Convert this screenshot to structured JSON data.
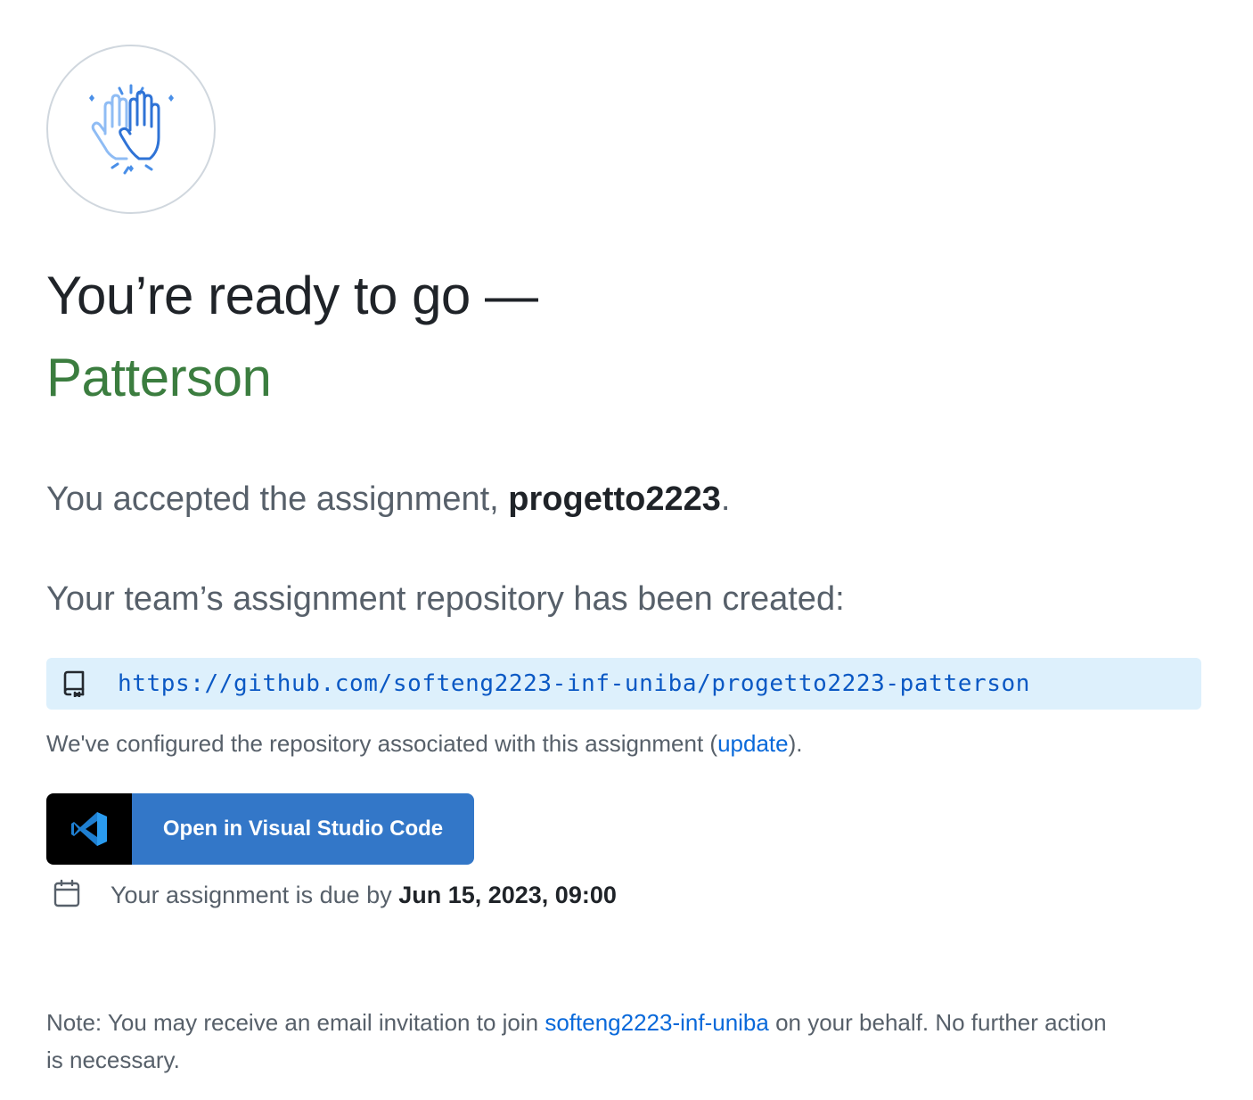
{
  "header": {
    "icon": "high-five-icon",
    "title_line": "You’re ready to go —",
    "name": "Patterson"
  },
  "assignment": {
    "accepted_prefix": "You accepted the assignment, ",
    "name": "progetto2223",
    "accepted_suffix": "."
  },
  "repository": {
    "created_text": "Your team’s assignment repository has been created:",
    "icon": "repo-icon",
    "url": "https://github.com/softeng2223-inf-uniba/progetto2223-patterson",
    "configured_prefix": "We've configured the repository associated with this assignment (",
    "update_link": "update",
    "configured_suffix": ")."
  },
  "actions": {
    "vscode_icon": "vscode-logo-icon",
    "vscode_label": "Open in Visual Studio Code"
  },
  "due": {
    "icon": "calendar-icon",
    "prefix": "Your assignment is due by ",
    "date": "Jun 15, 2023, 09:00"
  },
  "note": {
    "prefix": "Note: You may receive an email invitation to join ",
    "org_link": "softeng2223-inf-uniba",
    "suffix": " on your behalf. No further action is necessary."
  },
  "colors": {
    "name_green": "#3b7d3f",
    "link_blue": "#0969da",
    "repo_bg": "#ddf0fc",
    "button_blue": "#3377c8"
  }
}
